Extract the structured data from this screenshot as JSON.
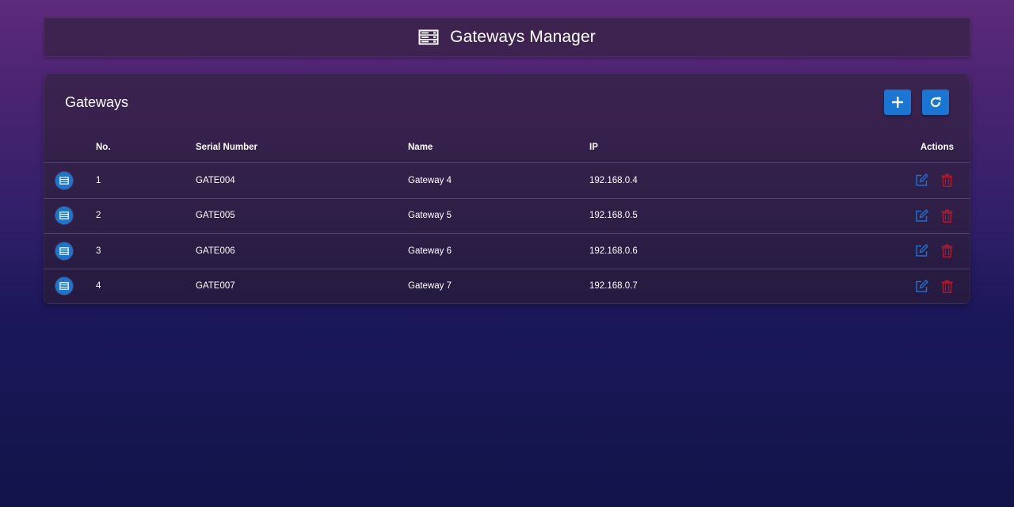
{
  "header": {
    "title": "Gateways Manager",
    "icon": "server-icon"
  },
  "card": {
    "title": "Gateways",
    "add_icon": "plus-icon",
    "refresh_icon": "refresh-icon"
  },
  "table": {
    "columns": {
      "no": "No.",
      "serial": "Serial Number",
      "name": "Name",
      "ip": "IP",
      "actions": "Actions"
    },
    "rows": [
      {
        "no": "1",
        "serial": "GATE004",
        "name": "Gateway 4",
        "ip": "192.168.0.4"
      },
      {
        "no": "2",
        "serial": "GATE005",
        "name": "Gateway 5",
        "ip": "192.168.0.5"
      },
      {
        "no": "3",
        "serial": "GATE006",
        "name": "Gateway 6",
        "ip": "192.168.0.6"
      },
      {
        "no": "4",
        "serial": "GATE007",
        "name": "Gateway 7",
        "ip": "192.168.0.7"
      }
    ]
  },
  "colors": {
    "accent": "#1976d2",
    "edit": "#1e6fd0",
    "delete": "#b0182a"
  }
}
